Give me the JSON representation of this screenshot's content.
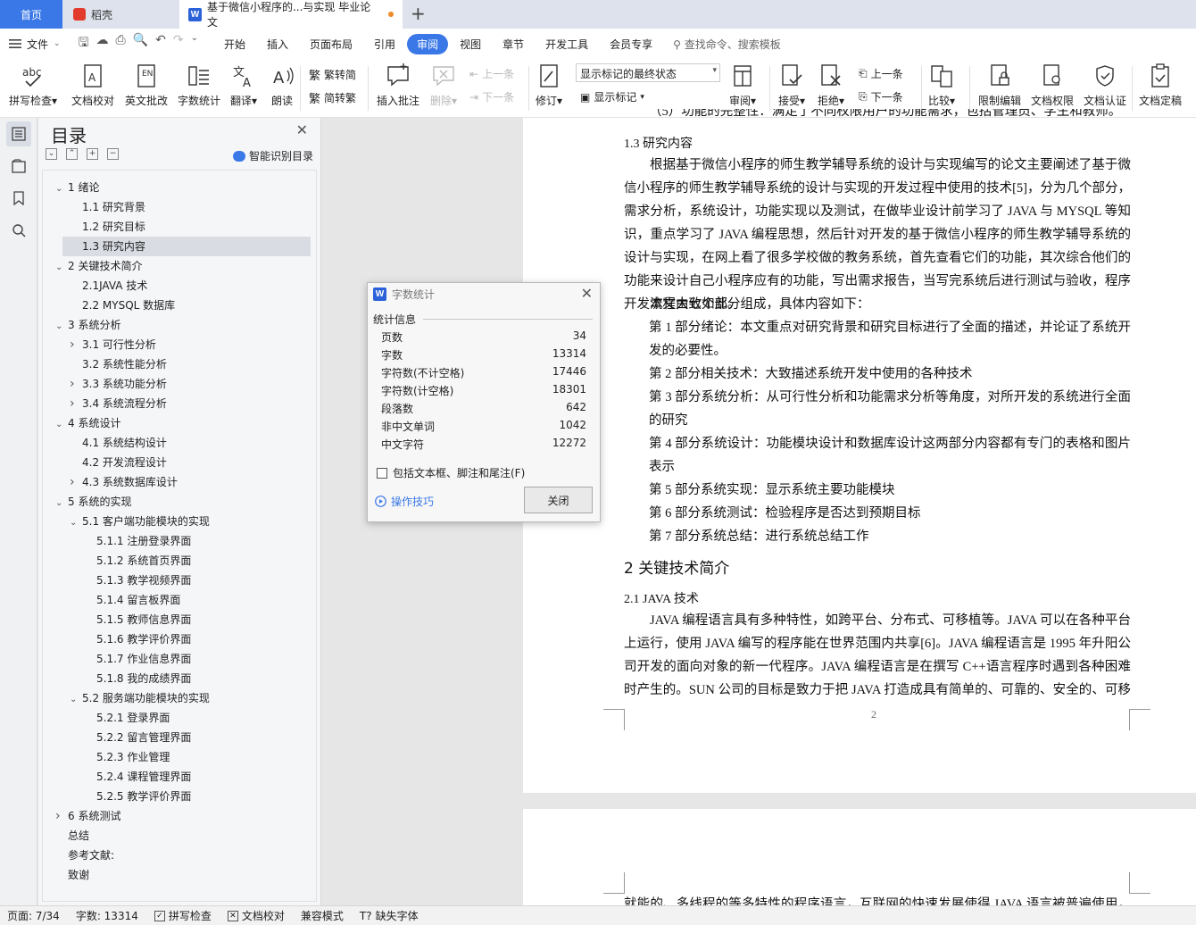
{
  "tabs": {
    "home": "首页",
    "daoke": "稻壳",
    "document": "基于微信小程序的...与实现 毕业论文"
  },
  "menu": {
    "file": "文件",
    "items": [
      "开始",
      "插入",
      "页面布局",
      "引用",
      "审阅",
      "视图",
      "章节",
      "开发工具",
      "会员专享"
    ],
    "active": "审阅",
    "search": "查找命令、搜索模板"
  },
  "ribbon": {
    "spell_check": "拼写检查",
    "doc_proof": "文档校对",
    "english_review": "英文批改",
    "word_count": "字数统计",
    "translate": "翻译",
    "read_aloud": "朗读",
    "trad_to_simp": "繁转简",
    "simp_to_trad": "简转繁",
    "insert_comment": "插入批注",
    "delete": "删除",
    "prev_comment": "上一条",
    "next_comment": "下一条",
    "revise": "修订",
    "markup_state": "显示标记的最终状态",
    "show_markup": "显示标记",
    "review": "审阅",
    "accept": "接受",
    "reject": "拒绝",
    "prev_change": "上一条",
    "next_change": "下一条",
    "compare": "比较",
    "restrict_edit": "限制编辑",
    "doc_permission": "文档权限",
    "doc_certify": "文档认证",
    "doc_finalize": "文档定稿"
  },
  "toc": {
    "title": "目录",
    "smart": "智能识别目录",
    "items": [
      {
        "label": "1  绪论",
        "level": 1,
        "chev": "down"
      },
      {
        "label": "1.1 研究背景",
        "level": 2,
        "chev": ""
      },
      {
        "label": "1.2 研究目标",
        "level": 2,
        "chev": ""
      },
      {
        "label": "1.3 研究内容",
        "level": 2,
        "chev": "",
        "selected": true
      },
      {
        "label": "2  关键技术简介",
        "level": 1,
        "chev": "down"
      },
      {
        "label": "2.1JAVA 技术",
        "level": 2,
        "chev": ""
      },
      {
        "label": "2.2 MYSQL 数据库",
        "level": 2,
        "chev": ""
      },
      {
        "label": "3  系统分析",
        "level": 1,
        "chev": "down"
      },
      {
        "label": "3.1 可行性分析",
        "level": 2,
        "chev": "right"
      },
      {
        "label": "3.2 系统性能分析",
        "level": 2,
        "chev": ""
      },
      {
        "label": "3.3 系统功能分析",
        "level": 2,
        "chev": "right"
      },
      {
        "label": "3.4 系统流程分析",
        "level": 2,
        "chev": "right"
      },
      {
        "label": "4  系统设计",
        "level": 1,
        "chev": "down"
      },
      {
        "label": "4.1 系统结构设计",
        "level": 2,
        "chev": ""
      },
      {
        "label": "4.2 开发流程设计",
        "level": 2,
        "chev": ""
      },
      {
        "label": "4.3 系统数据库设计",
        "level": 2,
        "chev": "right"
      },
      {
        "label": "5  系统的实现",
        "level": 1,
        "chev": "down"
      },
      {
        "label": "5.1 客户端功能模块的实现",
        "level": 2,
        "chev": "down"
      },
      {
        "label": "5.1.1 注册登录界面",
        "level": 3,
        "chev": ""
      },
      {
        "label": "5.1.2 系统首页界面",
        "level": 3,
        "chev": ""
      },
      {
        "label": "5.1.3 教学视频界面",
        "level": 3,
        "chev": ""
      },
      {
        "label": "5.1.4 留言板界面",
        "level": 3,
        "chev": ""
      },
      {
        "label": "5.1.5 教师信息界面",
        "level": 3,
        "chev": ""
      },
      {
        "label": "5.1.6 教学评价界面",
        "level": 3,
        "chev": ""
      },
      {
        "label": "5.1.7 作业信息界面",
        "level": 3,
        "chev": ""
      },
      {
        "label": "5.1.8 我的成绩界面",
        "level": 3,
        "chev": ""
      },
      {
        "label": "5.2 服务端功能模块的实现",
        "level": 2,
        "chev": "down"
      },
      {
        "label": "5.2.1 登录界面",
        "level": 3,
        "chev": ""
      },
      {
        "label": "5.2.2 留言管理界面",
        "level": 3,
        "chev": ""
      },
      {
        "label": "5.2.3 作业管理",
        "level": 3,
        "chev": ""
      },
      {
        "label": "5.2.4 课程管理界面",
        "level": 3,
        "chev": ""
      },
      {
        "label": "5.2.5 教学评价界面",
        "level": 3,
        "chev": ""
      },
      {
        "label": "6  系统测试",
        "level": 1,
        "chev": "right"
      },
      {
        "label": "总结",
        "level": 1,
        "chev": ""
      },
      {
        "label": "参考文献:",
        "level": 1,
        "chev": ""
      },
      {
        "label": "致谢",
        "level": 1,
        "chev": ""
      }
    ]
  },
  "document": {
    "partial_top": "（5）功能的完整性：满足了不同权限用户的功能需求，包括管理员、学生和教师。",
    "h_1_3": "1.3 研究内容",
    "p1": "根据基于微信小程序的师生教学辅导系统的设计与实现编写的论文主要阐述了基于微信小程序的师生教学辅导系统的设计与实现的开发过程中使用的技术[5]，分为几个部分，需求分析，系统设计，功能实现以及测试，在做毕业设计前学习了 JAVA 与 MYSQL 等知识，重点学习了 JAVA 编程思想，然后针对开发的基于微信小程序的师生教学辅导系统的设计与实现，在网上看了很多学校做的教务系统，首先查看它们的功能，其次综合他们的功能来设计自己小程序应有的功能，写出需求报告，当写完系统后进行测试与验收，程序开发流程大致如此。",
    "p2": "本文由七个部分组成，具体内容如下：",
    "parts": [
      "第 1 部分绪论：本文重点对研究背景和研究目标进行了全面的描述，并论证了系统开发的必要性。",
      "第 2 部分相关技术：大致描述系统开发中使用的各种技术",
      "第 3 部分系统分析：从可行性分析和功能需求分析等角度，对所开发的系统进行全面的研究",
      "第 4 部分系统设计：功能模块设计和数据库设计这两部分内容都有专门的表格和图片表示",
      "第 5 部分系统实现：显示系统主要功能模块",
      "第 6 部分系统测试：检验程序是否达到预期目标",
      "第 7 部分系统总结：进行系统总结工作"
    ],
    "h_2": "2  关键技术简介",
    "h_2_1": "2.1  JAVA 技术",
    "p3": "JAVA 编程语言具有多种特性，如跨平台、分布式、可移植等。JAVA 可以在各种平台上运行，使用 JAVA 编写的程序能在世界范围内共享[6]。JAVA 编程语言是 1995 年升阳公司开发的面向对象的新一代程序。JAVA 编程语言是在撰写  C++语言程序时遇到各种困难时产生的。SUN 公司的目标是致力于把 JAVA 打造成具有简单的、可靠的、安全的、可移植的、高编写",
    "page_number": "2",
    "next_page_partial": "就能的、多线程的等多特性的程序语言，互联网的快速发展使得 JAVA 语言被普遍使用，特别"
  },
  "dialog": {
    "title": "字数统计",
    "section": "统计信息",
    "rows": [
      {
        "label": "页数",
        "value": "34"
      },
      {
        "label": "字数",
        "value": "13314"
      },
      {
        "label": "字符数(不计空格)",
        "value": "17446"
      },
      {
        "label": "字符数(计空格)",
        "value": "18301"
      },
      {
        "label": "段落数",
        "value": "642"
      },
      {
        "label": "非中文单词",
        "value": "1042"
      },
      {
        "label": "中文字符",
        "value": "12272"
      }
    ],
    "checkbox": "包括文本框、脚注和尾注(F)",
    "tips": "操作技巧",
    "close": "关闭"
  },
  "status": {
    "page": "页面: 7/34",
    "words": "字数: 13314",
    "spell": "拼写检查",
    "proof": "文档校对",
    "compat": "兼容模式",
    "missing_font": "缺失字体"
  }
}
